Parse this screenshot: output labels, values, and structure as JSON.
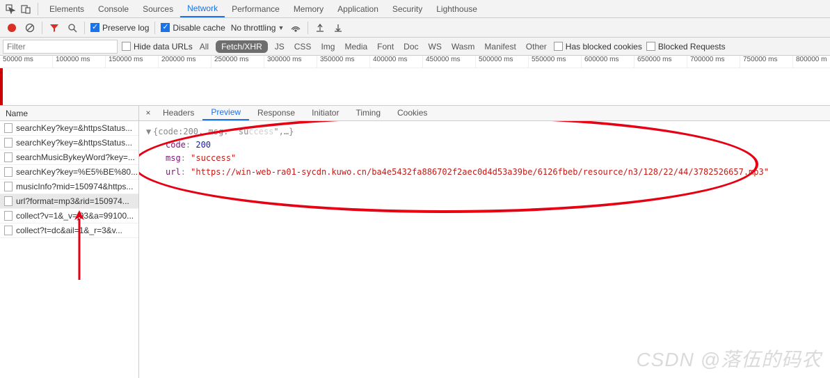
{
  "top_tabs": {
    "elements": "Elements",
    "console": "Console",
    "sources": "Sources",
    "network": "Network",
    "performance": "Performance",
    "memory": "Memory",
    "application": "Application",
    "security": "Security",
    "lighthouse": "Lighthouse",
    "active": "network"
  },
  "toolbar": {
    "preserve_log": "Preserve log",
    "disable_cache": "Disable cache",
    "throttling": "No throttling"
  },
  "filter_bar": {
    "placeholder": "Filter",
    "hide_data_urls": "Hide data URLs",
    "all": "All",
    "fetchxhr": "Fetch/XHR",
    "js": "JS",
    "css": "CSS",
    "img": "Img",
    "media": "Media",
    "font": "Font",
    "doc": "Doc",
    "ws": "WS",
    "wasm": "Wasm",
    "manifest": "Manifest",
    "other": "Other",
    "has_blocked_cookies": "Has blocked cookies",
    "blocked_requests": "Blocked Requests"
  },
  "timeline_ticks": [
    "50000 ms",
    "100000 ms",
    "150000 ms",
    "200000 ms",
    "250000 ms",
    "300000 ms",
    "350000 ms",
    "400000 ms",
    "450000 ms",
    "500000 ms",
    "550000 ms",
    "600000 ms",
    "650000 ms",
    "700000 ms",
    "750000 ms",
    "800000 m"
  ],
  "name_header": "Name",
  "requests": [
    {
      "label": "searchKey?key=&httpsStatus..."
    },
    {
      "label": "searchKey?key=&httpsStatus..."
    },
    {
      "label": "searchMusicBykeyWord?key=..."
    },
    {
      "label": "searchKey?key=%E5%BE%80..."
    },
    {
      "label": "musicInfo?mid=150974&https..."
    },
    {
      "label": "url?format=mp3&rid=150974...",
      "selected": true
    },
    {
      "label": "collect?v=1&_v=j93&a=99100..."
    },
    {
      "label": "collect?t=dc&ail=1&_r=3&v..."
    }
  ],
  "detail_tabs": {
    "headers": "Headers",
    "preview": "Preview",
    "response": "Response",
    "initiator": "Initiator",
    "timing": "Timing",
    "cookies": "Cookies",
    "active": "preview"
  },
  "preview_json": {
    "summary_prefix": "{code: ",
    "summary_code": "200",
    "summary_mid": ", msg: \"su",
    "summary_suffix": "\",…}",
    "code_key": "code",
    "code_val": "200",
    "msg_key": "msg",
    "msg_val": "\"success\"",
    "url_key": "url",
    "url_val": "\"https://win-web-ra01-sycdn.kuwo.cn/ba4e5432fa886702f2aec0d4d53a39be/6126fbeb/resource/n3/128/22/44/3782526657.mp3\""
  },
  "watermark": "CSDN @落伍的码农"
}
